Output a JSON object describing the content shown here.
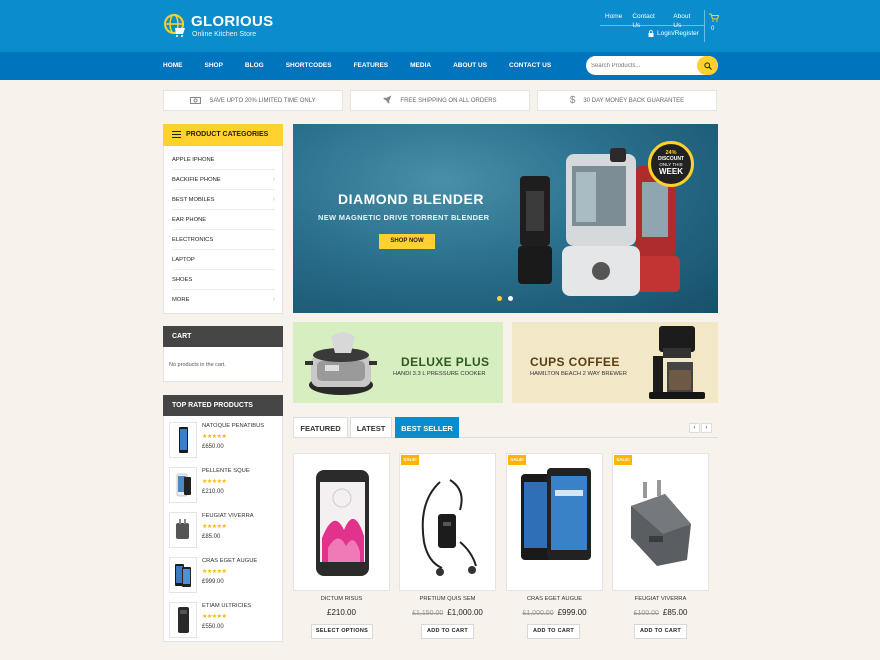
{
  "header": {
    "site_title": "GLORIOUS",
    "site_tagline": "Online Kitchen Store",
    "top_links": [
      "Home",
      "Contact Us",
      "About Us"
    ],
    "login_label": "Login/Register",
    "cart_count": "0",
    "accent_color": "#ffd12e",
    "brand_color": "#0a8ccd"
  },
  "nav": {
    "items": [
      "HOME",
      "SHOP",
      "BLOG",
      "SHORTCODES",
      "FEATURES",
      "MEDIA",
      "ABOUT US",
      "CONTACT US"
    ],
    "search_placeholder": "Search Products..."
  },
  "features": [
    {
      "icon": "money-icon",
      "text": "SAVE UPTO 20% LIMITED TIME ONLY"
    },
    {
      "icon": "rocket-icon",
      "text": "FREE SHIPPING ON ALL ORDERS"
    },
    {
      "icon": "dollar-icon",
      "text": "30 DAY MONEY BACK GUARANTEE"
    }
  ],
  "sidebar": {
    "categories_title": "PRODUCT CATEGORIES",
    "categories": [
      {
        "label": "APPLE IPHONE",
        "has_children": false
      },
      {
        "label": "BACKIFIE PHONE",
        "has_children": true
      },
      {
        "label": "BEST MOBILES",
        "has_children": true
      },
      {
        "label": "EAR PHONE",
        "has_children": false
      },
      {
        "label": "ELECTRONICS",
        "has_children": false
      },
      {
        "label": "LAPTOP",
        "has_children": false
      },
      {
        "label": "SHOES",
        "has_children": false
      },
      {
        "label": "MORE",
        "has_children": true
      }
    ],
    "cart_title": "CART",
    "cart_empty": "No products in the cart.",
    "top_rated_title": "TOP RATED PRODUCTS",
    "top_rated": [
      {
        "name": "NATOQUE PENATIBUS",
        "rating": 5,
        "price": "£650.00"
      },
      {
        "name": "PELLENTE SQUE",
        "rating": 5,
        "price": "£210.00"
      },
      {
        "name": "FEUGIAT VIVERRA",
        "rating": 5,
        "price": "£85.00"
      },
      {
        "name": "CRAS EGET AUGUE",
        "rating": 5,
        "price": "£999.00"
      },
      {
        "name": "ETIAM ULTRICIES",
        "rating": 5,
        "price": "£550.00"
      }
    ]
  },
  "hero": {
    "title": "DIAMOND BLENDER",
    "subtitle": "NEW MAGNETIC DRIVE TORRENT BLENDER",
    "button": "SHOP NOW",
    "badge_percent": "24%",
    "badge_discount": "DISCOUNT",
    "badge_only": "ONLY THIS",
    "badge_week": "WEEK",
    "active_slide": 1,
    "slide_count": 2
  },
  "promos": [
    {
      "title": "DELUXE PLUS",
      "subtitle": "HANDI 3.3 L PRESSURE COOKER",
      "bg": "#d7efc0",
      "title_color": "#2f5a1c"
    },
    {
      "title": "CUPS COFFEE",
      "subtitle": "HAMILTON BEACH 2 WAY BREWER",
      "bg": "#f2e8c8",
      "title_color": "#5a3e12"
    }
  ],
  "tabs": {
    "items": [
      "FEATURED",
      "LATEST",
      "BEST SELLER"
    ],
    "active": "BEST SELLER",
    "prev": "‹",
    "next": "›"
  },
  "products": [
    {
      "name": "DICTUM RISUS",
      "old_price": "",
      "price": "£210.00",
      "button": "SELECT OPTIONS",
      "sale": false
    },
    {
      "name": "PRETIUM QUIS SEM",
      "old_price": "£1,150.00",
      "price": "£1,000.00",
      "button": "ADD TO CART",
      "sale": true
    },
    {
      "name": "CRAS EGET AUGUE",
      "old_price": "£1,000.00",
      "price": "£999.00",
      "button": "ADD TO CART",
      "sale": true
    },
    {
      "name": "FEUGIAT VIVERRA",
      "old_price": "£100.00",
      "price": "£85.00",
      "button": "ADD TO CART",
      "sale": true
    }
  ],
  "sale_label": "SALE!"
}
